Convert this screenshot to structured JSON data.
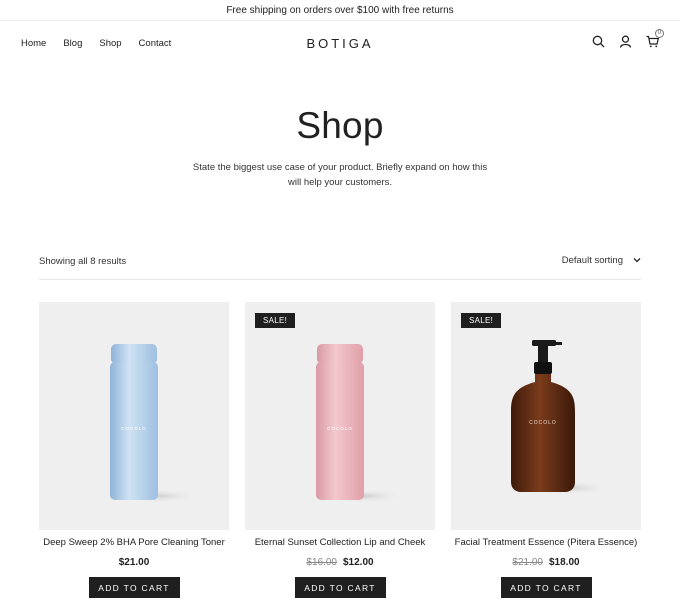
{
  "announcement": "Free shipping on orders over $100 with free returns",
  "header": {
    "nav": [
      "Home",
      "Blog",
      "Shop",
      "Contact"
    ],
    "logo": "BOTIGA",
    "cart_count": "0",
    "icons": [
      "search-icon",
      "user-icon",
      "cart-icon"
    ]
  },
  "hero": {
    "title": "Shop",
    "description": "State the biggest use case of your product. Briefly expand on how this will help your customers."
  },
  "toolbar": {
    "results": "Showing all 8 results",
    "sorting": "Default sorting"
  },
  "products": [
    {
      "name": "Deep Sweep 2% BHA Pore Cleaning Toner",
      "price": "$21.00",
      "old_price": "",
      "sale": "",
      "button": "ADD TO CART",
      "bottle_label": "COCOLO"
    },
    {
      "name": "Eternal Sunset Collection Lip and Cheek",
      "price": "$12.00",
      "old_price": "$16.00",
      "sale": "SALE!",
      "button": "ADD TO CART",
      "bottle_label": "COCOLO"
    },
    {
      "name": "Facial Treatment Essence (Pitera Essence)",
      "price": "$18.00",
      "old_price": "$21.00",
      "sale": "SALE!",
      "button": "ADD TO CART",
      "bottle_label": "COCOLO"
    }
  ],
  "colors": {
    "button_bg": "#1f1f1f",
    "image_bg": "#efefef",
    "bottle_blue": "#a9c9e6",
    "bottle_pink": "#e4aab2",
    "bottle_amber": "#5a2a14"
  }
}
